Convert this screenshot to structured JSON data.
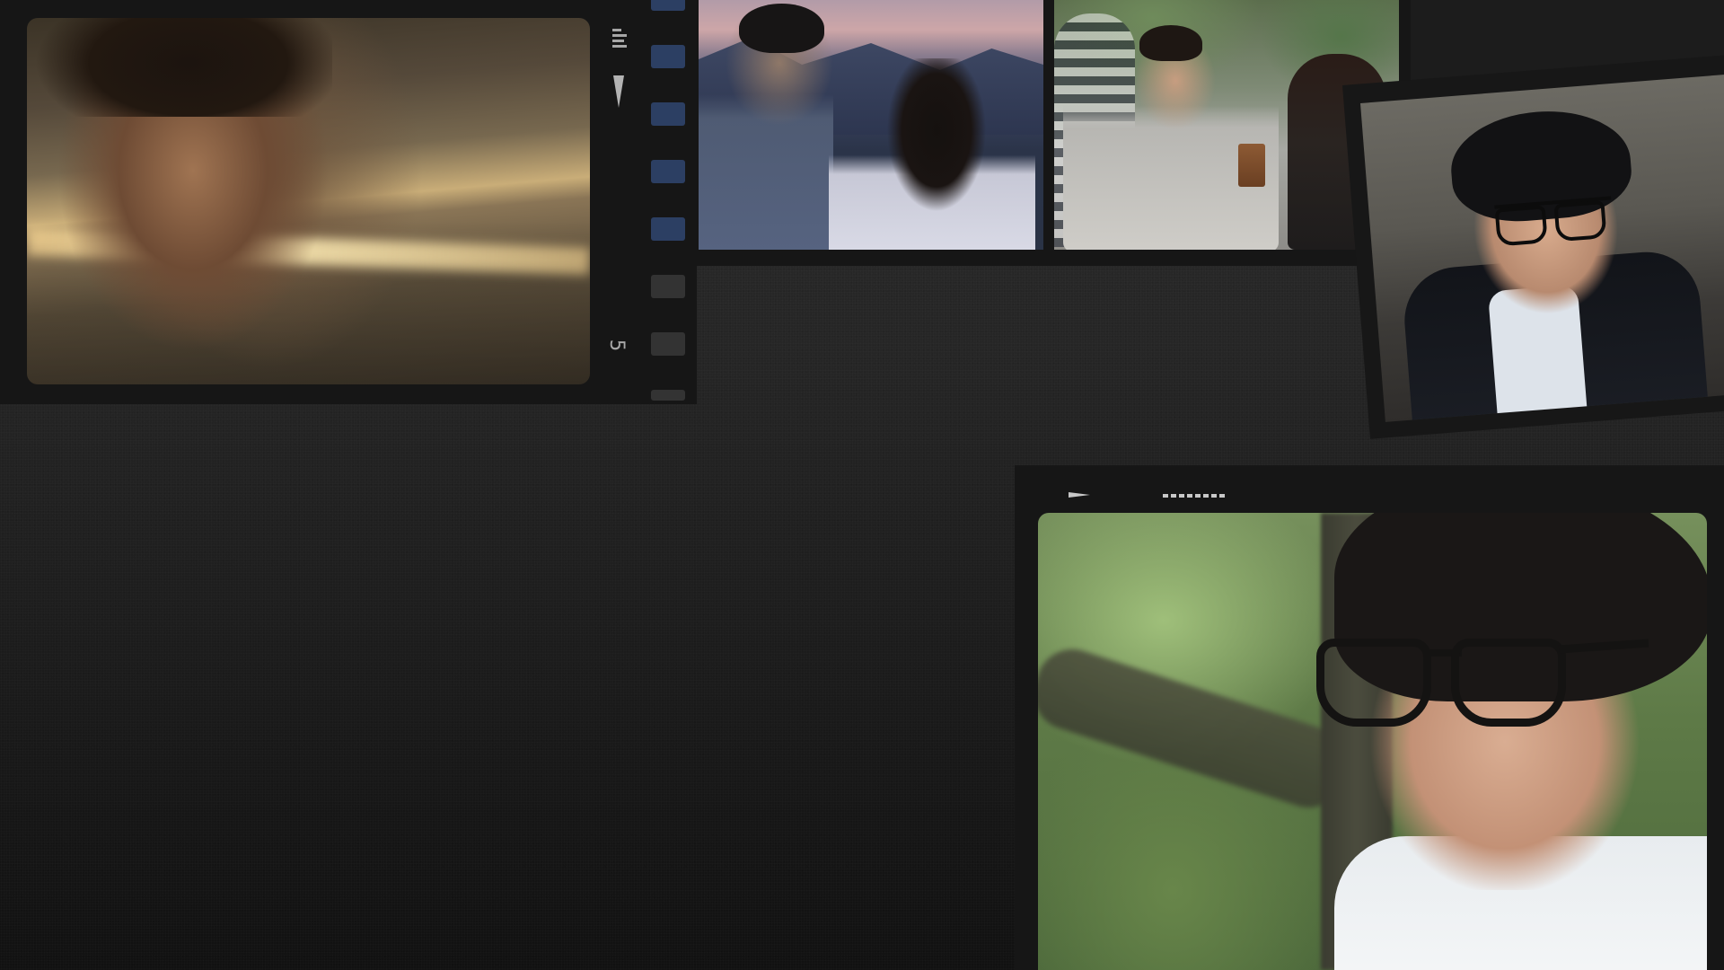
{
  "page": {
    "background_top": "#2a2a2a",
    "background_bottom": "#111111",
    "strip_color": "#161616",
    "perforation_accent": "#2c3f63"
  },
  "strip_top_left": {
    "frame_number": "5",
    "icons": [
      "level-bars-icon",
      "down-arrow-marker-icon"
    ]
  },
  "strip_bottom_right": {
    "icons": [
      "right-arrow-marker-icon",
      "dashed-line-marker"
    ]
  },
  "frames": [
    {
      "id": "frame-1",
      "description_name": "man-smiling-warm-light-still"
    },
    {
      "id": "frame-2",
      "description_name": "couple-at-dusk-still"
    },
    {
      "id": "frame-3",
      "description_name": "man-with-coffee-still"
    },
    {
      "id": "frame-4",
      "description_name": "man-with-glasses-laughing-still"
    },
    {
      "id": "frame-5",
      "description_name": "man-with-glasses-outdoors-still"
    }
  ]
}
